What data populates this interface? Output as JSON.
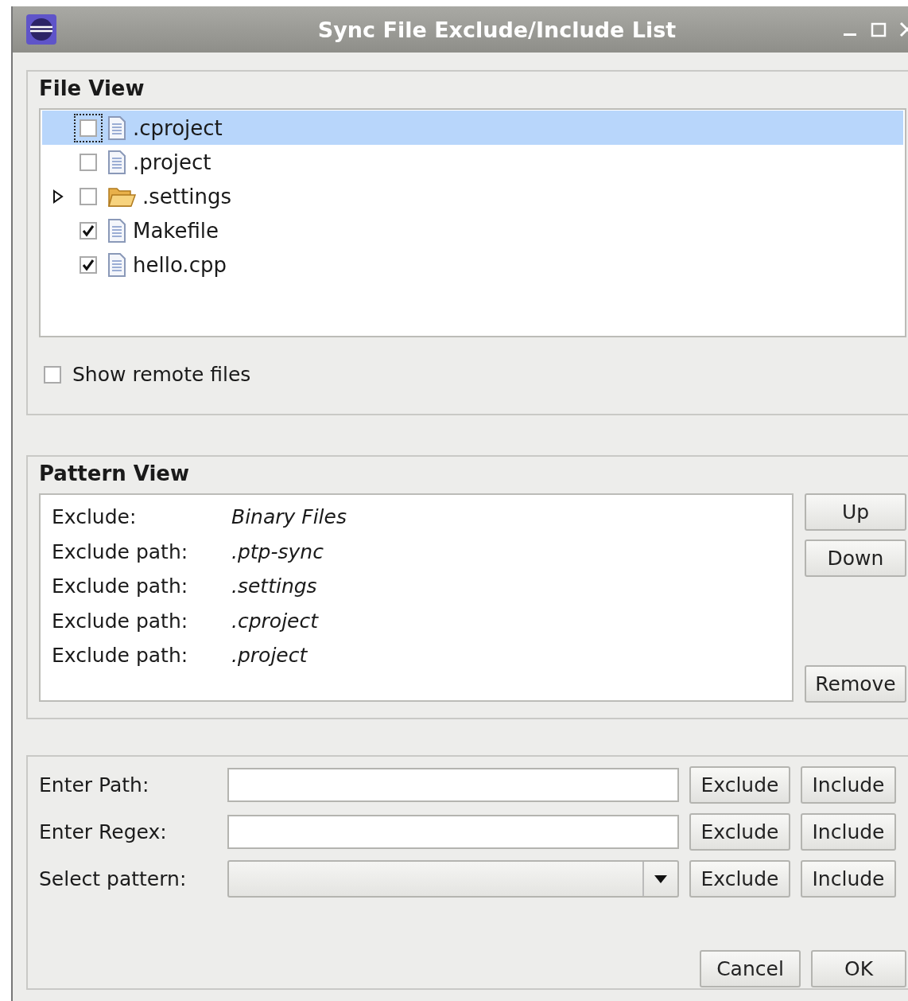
{
  "window": {
    "title": "Sync File Exclude/Include List"
  },
  "file_view": {
    "title": "File View",
    "tree": [
      {
        "name": ".cproject",
        "kind": "file",
        "checked": false,
        "selected": true
      },
      {
        "name": ".project",
        "kind": "file",
        "checked": false,
        "selected": false
      },
      {
        "name": ".settings",
        "kind": "folder",
        "checked": false,
        "selected": false,
        "expanded": false
      },
      {
        "name": "Makefile",
        "kind": "file",
        "checked": true,
        "selected": false
      },
      {
        "name": "hello.cpp",
        "kind": "file",
        "checked": true,
        "selected": false
      }
    ],
    "show_remote_files": {
      "label": "Show remote files",
      "checked": false
    }
  },
  "pattern_view": {
    "title": "Pattern View",
    "patterns": [
      {
        "type": "Exclude:",
        "value": "Binary Files"
      },
      {
        "type": "Exclude path:",
        "value": ".ptp-sync"
      },
      {
        "type": "Exclude path:",
        "value": ".settings"
      },
      {
        "type": "Exclude path:",
        "value": ".cproject"
      },
      {
        "type": "Exclude path:",
        "value": ".project"
      }
    ],
    "buttons": [
      "Up",
      "Down",
      "Remove"
    ]
  },
  "entry": {
    "rows": [
      {
        "label": "Enter Path:",
        "kind": "text",
        "buttons": [
          "Exclude",
          "Include"
        ]
      },
      {
        "label": "Enter Regex:",
        "kind": "text",
        "buttons": [
          "Exclude",
          "Include"
        ]
      },
      {
        "label": "Select pattern:",
        "kind": "select",
        "buttons": [
          "Exclude",
          "Include"
        ]
      }
    ],
    "buttons": [
      "Cancel",
      "OK"
    ]
  }
}
